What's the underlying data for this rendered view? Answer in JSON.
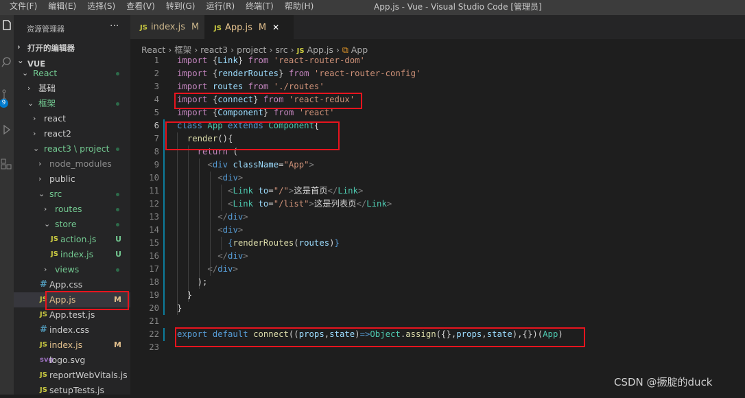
{
  "menu": [
    "文件(F)",
    "编辑(E)",
    "选择(S)",
    "查看(V)",
    "转到(G)",
    "运行(R)",
    "终端(T)",
    "帮助(H)"
  ],
  "window_title": "App.js - Vue - Visual Studio Code [管理员]",
  "activity_badge": "9",
  "explorer": {
    "title": "资源管理器",
    "more": "···",
    "open_editors": "打开的编辑器",
    "root": "VUE",
    "tree": [
      {
        "label": "React",
        "chev": "⌄",
        "indent": 1,
        "dot": true,
        "color": "#73c991"
      },
      {
        "label": "基础",
        "chev": "›",
        "indent": 2
      },
      {
        "label": "框架",
        "chev": "⌄",
        "indent": 2,
        "dot": true,
        "color": "#73c991"
      },
      {
        "label": "react",
        "chev": "›",
        "indent": 3
      },
      {
        "label": "react2",
        "chev": "›",
        "indent": 3
      },
      {
        "label": "react3 \\ project",
        "chev": "⌄",
        "indent": 3,
        "dot": true,
        "color": "#73c991"
      },
      {
        "label": "node_modules",
        "chev": "›",
        "indent": 4,
        "color": "#8c8c8c"
      },
      {
        "label": "public",
        "chev": "›",
        "indent": 4
      },
      {
        "label": "src",
        "chev": "⌄",
        "indent": 4,
        "dot": true,
        "color": "#73c991"
      },
      {
        "label": "routes",
        "chev": "›",
        "indent": 5,
        "dot": true,
        "color": "#73c991"
      },
      {
        "label": "store",
        "chev": "⌄",
        "indent": 5,
        "dot": true,
        "color": "#73c991"
      },
      {
        "label": "action.js",
        "icon": "JS",
        "indent": 6,
        "status": "U",
        "color": "#73c991"
      },
      {
        "label": "index.js",
        "icon": "JS",
        "indent": 6,
        "status": "U",
        "color": "#73c991"
      },
      {
        "label": "views",
        "chev": "›",
        "indent": 5,
        "dot": true,
        "color": "#73c991"
      },
      {
        "label": "App.css",
        "icon": "#",
        "indent": 4
      },
      {
        "label": "App.js",
        "icon": "JS",
        "indent": 4,
        "status": "M",
        "color": "#e2c08d",
        "selected": true
      },
      {
        "label": "App.test.js",
        "icon": "JS",
        "indent": 4
      },
      {
        "label": "index.css",
        "icon": "#",
        "indent": 4
      },
      {
        "label": "index.js",
        "icon": "JS",
        "indent": 4,
        "status": "M",
        "color": "#e2c08d"
      },
      {
        "label": "logo.svg",
        "icon": "svg",
        "indent": 4
      },
      {
        "label": "reportWebVitals.js",
        "icon": "JS",
        "indent": 4
      },
      {
        "label": "setupTests.js",
        "icon": "JS",
        "indent": 4
      }
    ]
  },
  "tabs": [
    {
      "icon": "JS",
      "label": "index.js",
      "status": "M",
      "active": false
    },
    {
      "icon": "JS",
      "label": "App.js",
      "status": "M",
      "close": "✕",
      "active": true
    }
  ],
  "breadcrumb": [
    "React",
    "框架",
    "react3",
    "project",
    "src",
    "JS App.js",
    "App"
  ],
  "code": [
    [
      [
        "kw",
        "import "
      ],
      [
        "pl",
        "{"
      ],
      [
        "var",
        "Link"
      ],
      [
        "pl",
        "} "
      ],
      [
        "kw",
        "from "
      ],
      [
        "str",
        "'react-router-dom'"
      ]
    ],
    [
      [
        "kw",
        "import "
      ],
      [
        "pl",
        "{"
      ],
      [
        "var",
        "renderRoutes"
      ],
      [
        "pl",
        "} "
      ],
      [
        "kw",
        "from "
      ],
      [
        "str",
        "'react-router-config'"
      ]
    ],
    [
      [
        "kw",
        "import "
      ],
      [
        "var",
        "routes "
      ],
      [
        "kw",
        "from "
      ],
      [
        "str",
        "'./routes'"
      ]
    ],
    [
      [
        "kw",
        "import "
      ],
      [
        "pl",
        "{"
      ],
      [
        "var",
        "connect"
      ],
      [
        "pl",
        "} "
      ],
      [
        "kw",
        "from "
      ],
      [
        "str",
        "'react-redux'"
      ]
    ],
    [
      [
        "kw",
        "import "
      ],
      [
        "pl",
        "{"
      ],
      [
        "var",
        "Component"
      ],
      [
        "pl",
        "} "
      ],
      [
        "kw",
        "from "
      ],
      [
        "str",
        "'react'"
      ]
    ],
    [
      [
        "bl",
        "class "
      ],
      [
        "cls",
        "App "
      ],
      [
        "bl",
        "extends "
      ],
      [
        "cls",
        "Component"
      ],
      [
        "pl",
        "{"
      ]
    ],
    [
      [
        "pl",
        "  "
      ],
      [
        "fn",
        "render"
      ],
      [
        "pl",
        "(){"
      ]
    ],
    [
      [
        "pl",
        "    "
      ],
      [
        "kw",
        "return "
      ],
      [
        "pl",
        "("
      ]
    ],
    [
      [
        "pl",
        "      "
      ],
      [
        "gy",
        "<"
      ],
      [
        "tag",
        "div "
      ],
      [
        "var",
        "className"
      ],
      [
        "pl",
        "="
      ],
      [
        "str",
        "\"App\""
      ],
      [
        "gy",
        ">"
      ]
    ],
    [
      [
        "pl",
        "        "
      ],
      [
        "gy",
        "<"
      ],
      [
        "tag",
        "div"
      ],
      [
        "gy",
        ">"
      ]
    ],
    [
      [
        "pl",
        "          "
      ],
      [
        "gy",
        "<"
      ],
      [
        "cls",
        "Link "
      ],
      [
        "var",
        "to"
      ],
      [
        "pl",
        "="
      ],
      [
        "str",
        "\"/\""
      ],
      [
        "gy",
        ">"
      ],
      [
        "pl",
        "这是首页"
      ],
      [
        "gy",
        "</"
      ],
      [
        "cls",
        "Link"
      ],
      [
        "gy",
        ">"
      ]
    ],
    [
      [
        "pl",
        "          "
      ],
      [
        "gy",
        "<"
      ],
      [
        "cls",
        "Link "
      ],
      [
        "var",
        "to"
      ],
      [
        "pl",
        "="
      ],
      [
        "str",
        "\"/list\""
      ],
      [
        "gy",
        ">"
      ],
      [
        "pl",
        "这是列表页"
      ],
      [
        "gy",
        "</"
      ],
      [
        "cls",
        "Link"
      ],
      [
        "gy",
        ">"
      ]
    ],
    [
      [
        "pl",
        "        "
      ],
      [
        "gy",
        "</"
      ],
      [
        "tag",
        "div"
      ],
      [
        "gy",
        ">"
      ]
    ],
    [
      [
        "pl",
        "        "
      ],
      [
        "gy",
        "<"
      ],
      [
        "tag",
        "div"
      ],
      [
        "gy",
        ">"
      ]
    ],
    [
      [
        "pl",
        "          "
      ],
      [
        "bl",
        "{"
      ],
      [
        "fn",
        "renderRoutes"
      ],
      [
        "pl",
        "("
      ],
      [
        "var",
        "routes"
      ],
      [
        "pl",
        ")"
      ],
      [
        "bl",
        "}"
      ]
    ],
    [
      [
        "pl",
        "        "
      ],
      [
        "gy",
        "</"
      ],
      [
        "tag",
        "div"
      ],
      [
        "gy",
        ">"
      ]
    ],
    [
      [
        "pl",
        "      "
      ],
      [
        "gy",
        "</"
      ],
      [
        "tag",
        "div"
      ],
      [
        "gy",
        ">"
      ]
    ],
    [
      [
        "pl",
        "    );"
      ]
    ],
    [
      [
        "pl",
        "  }"
      ]
    ],
    [
      [
        "pl",
        "}"
      ]
    ],
    [],
    [
      [
        "bl",
        "export default "
      ],
      [
        "fn",
        "connect"
      ],
      [
        "pl",
        "(("
      ],
      [
        "var",
        "props"
      ],
      [
        "pl",
        ","
      ],
      [
        "var",
        "state"
      ],
      [
        "pl",
        ")"
      ],
      [
        "bl",
        "=>"
      ],
      [
        "cls",
        "Object"
      ],
      [
        "pl",
        "."
      ],
      [
        "fn",
        "assign"
      ],
      [
        "pl",
        "({},"
      ],
      [
        "var",
        "props"
      ],
      [
        "pl",
        ","
      ],
      [
        "var",
        "state"
      ],
      [
        "pl",
        "),{})("
      ],
      [
        "cls",
        "App"
      ],
      [
        "pl",
        ")"
      ]
    ],
    []
  ],
  "current_line": 6,
  "watermark": "CSDN @撅腚的duck"
}
